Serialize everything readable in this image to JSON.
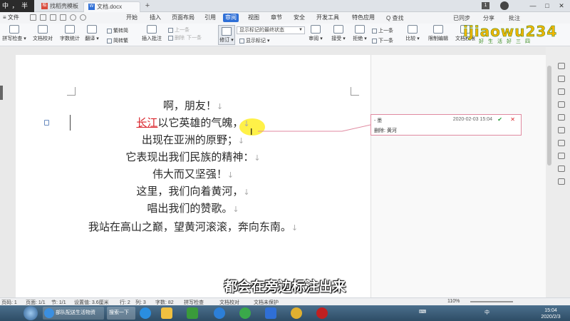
{
  "titlebar": {
    "ime_text": "中 ， 半",
    "tabs": [
      "找稻壳模板",
      "文档.docx"
    ],
    "doc_icon": "W",
    "add_tab": "+",
    "page_badge": "1",
    "window_buttons": [
      "—",
      "□",
      "✕"
    ]
  },
  "menubar": {
    "file": "≡ 文件",
    "tabs": [
      "开始",
      "插入",
      "页面布局",
      "引用",
      "审阅",
      "视图",
      "章节",
      "安全",
      "开发工具",
      "特色应用"
    ],
    "active_tab": "审阅",
    "search": "Q 查找",
    "right": [
      "已同步",
      "分享",
      "批注"
    ]
  },
  "ribbon": {
    "buttons": [
      {
        "label": "拼写检查 ▾"
      },
      {
        "label": "文档校对"
      },
      {
        "label": "字数统计"
      },
      {
        "label": "翻译 ▾"
      },
      {
        "label": "插入批注"
      }
    ],
    "small": {
      "trad": "繁转简",
      "simp": "简转繁",
      "prev_dim": "上一条",
      "next_dim": "下一条",
      "delete_dim": "删除",
      "show_markup": "显示标记 ▾",
      "review": "审阅 ▾",
      "accept": "接受 ▾",
      "reject": "拒绝 ▾",
      "prev": "上一条",
      "next": "下一条",
      "compare": "比较 ▾",
      "restrict": "限制编辑",
      "protect": "文档权限"
    },
    "track_changes_label": "修订 ▾",
    "markup_combo": "显示标记的最终状态"
  },
  "logo": {
    "main": "ijiaowu234",
    "sub": "好生活好三四"
  },
  "document": {
    "lines": [
      {
        "text": "啊，朋友！"
      },
      {
        "deleted": "长江",
        "text": "以它英雄的气魄，"
      },
      {
        "text": "出现在亚洲的原野；"
      },
      {
        "text": "它表现出我们民族的精神："
      },
      {
        "text": "伟大而又坚强！"
      },
      {
        "text": "这里，我们向着黄河，"
      },
      {
        "text": "唱出我们的赞歌。"
      },
      {
        "text": "我站在高山之巅，望黄河滚滚，奔向东南。"
      }
    ],
    "para_mark": "↓"
  },
  "comment": {
    "author": "- 墨",
    "time": "2020-02-03 15:04",
    "accept_icon": "✔",
    "reject_icon": "✕",
    "body": "删除: 黄河"
  },
  "subtitle": "都会在旁边标注出来",
  "statusbar": {
    "page": "页码: 1",
    "pages": "页面: 1/1",
    "section": "节: 1/1",
    "setting": "设置值: 3.6厘米",
    "row": "行: 2",
    "col": "列: 3",
    "words": "字数: 82",
    "spell": "拼写检查",
    "proof": "文档校对",
    "protect": "文档未保护",
    "zoom": "110%"
  },
  "taskbar": {
    "browser_item": "部队配送生活物资",
    "search_item": "搜索一下",
    "tray_lang": "中",
    "clock_time": "15:04",
    "clock_date": "2020/2/3"
  },
  "colors": {
    "accent": "#2f6fd6",
    "deleted_text": "#d9232a",
    "highlight": "#ffee28",
    "accept": "#2a9a3a"
  }
}
